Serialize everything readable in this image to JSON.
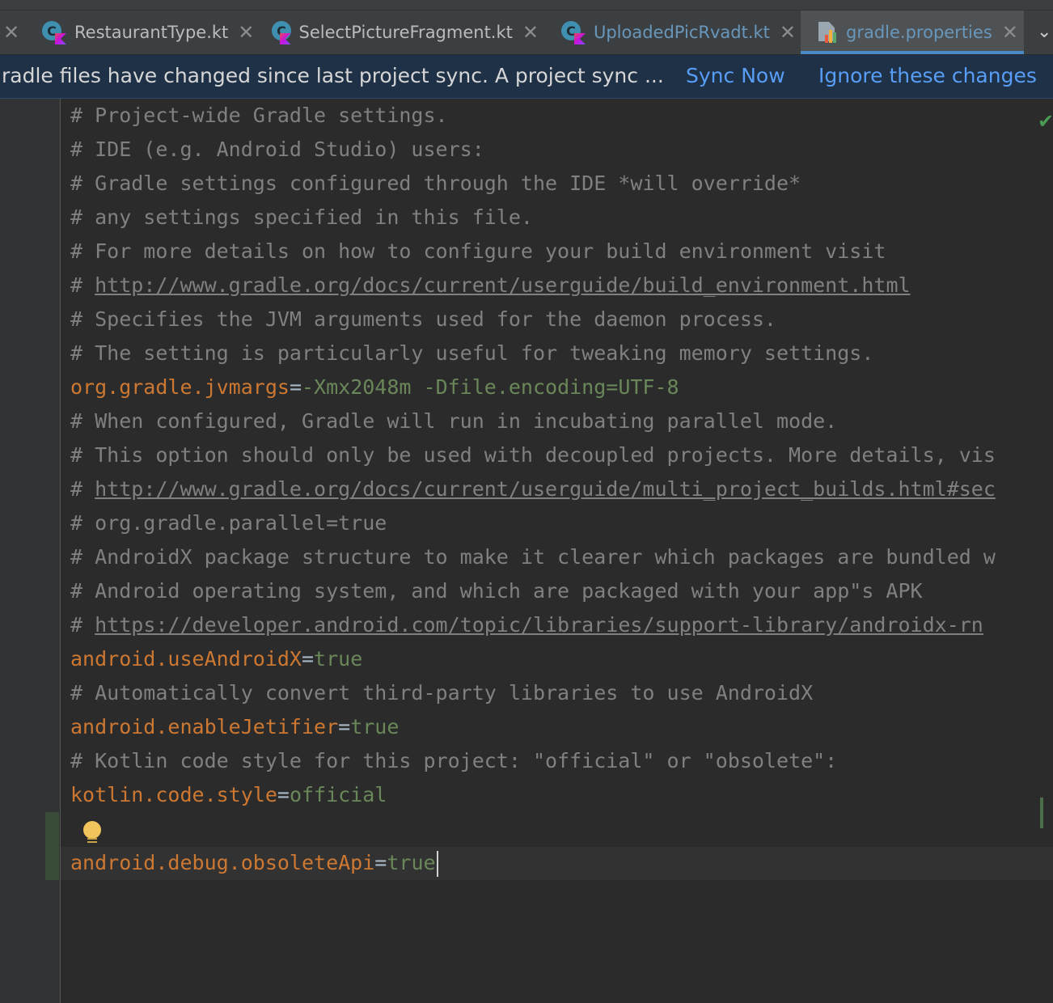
{
  "tabs": [
    {
      "label": "RestaurantType.kt",
      "active": false,
      "modified": false
    },
    {
      "label": "SelectPictureFragment.kt",
      "active": false,
      "modified": false
    },
    {
      "label": "UploadedPicRvadt.kt",
      "active": false,
      "modified": true
    },
    {
      "label": "gradle.properties",
      "active": true,
      "modified": true
    }
  ],
  "notification": {
    "message": "radle files have changed since last project sync. A project sync ...",
    "sync_now": "Sync Now",
    "ignore": "Ignore these changes"
  },
  "code": [
    {
      "comment": "# Project-wide Gradle settings."
    },
    {
      "comment": "# IDE (e.g. Android Studio) users:"
    },
    {
      "comment": "# Gradle settings configured through the IDE *will override*"
    },
    {
      "comment": "# any settings specified in this file."
    },
    {
      "comment": "# For more details on how to configure your build environment visit"
    },
    {
      "comment": "# ",
      "url": "http://www.gradle.org/docs/current/userguide/build_environment.html"
    },
    {
      "comment": "# Specifies the JVM arguments used for the daemon process."
    },
    {
      "comment": "# The setting is particularly useful for tweaking memory settings."
    },
    {
      "key": "org.gradle.jvmargs",
      "eq": "=",
      "value": "-Xmx2048m -Dfile.encoding=UTF-8"
    },
    {
      "comment": "# When configured, Gradle will run in incubating parallel mode."
    },
    {
      "comment": "# This option should only be used with decoupled projects. More details, vis"
    },
    {
      "comment": "# ",
      "url": "http://www.gradle.org/docs/current/userguide/multi_project_builds.html#sec"
    },
    {
      "comment": "# org.gradle.parallel=true"
    },
    {
      "comment": "# AndroidX package structure to make it clearer which packages are bundled w"
    },
    {
      "comment": "# Android operating system, and which are packaged with your app\"s APK"
    },
    {
      "comment": "# ",
      "url": "https://developer.android.com/topic/libraries/support-library/androidx-rn"
    },
    {
      "key": "android.useAndroidX",
      "eq": "=",
      "value": "true"
    },
    {
      "comment": "# Automatically convert third-party libraries to use AndroidX"
    },
    {
      "key": "android.enableJetifier",
      "eq": "=",
      "value": "true"
    },
    {
      "comment": "# Kotlin code style for this project: \"official\" or \"obsolete\":"
    },
    {
      "key": "kotlin.code.style",
      "eq": "=",
      "value": "official"
    },
    {
      "blank": true
    },
    {
      "key": "android.debug.obsoleteApi",
      "eq": "=",
      "value": "true",
      "cursor": true
    }
  ],
  "icons": {
    "close": "close-icon",
    "kotlin_file": "kotlin-file-icon",
    "properties_file": "properties-file-icon",
    "more_tabs": "chevron-down-icon",
    "intention": "lightbulb-icon",
    "inspection_ok": "checkmark-icon"
  },
  "colors": {
    "comment": "#808080",
    "key": "#cc7832",
    "value": "#6a8759",
    "link": "#589df6",
    "modified_tab": "#6897bb",
    "accent": "#4a88c7"
  }
}
